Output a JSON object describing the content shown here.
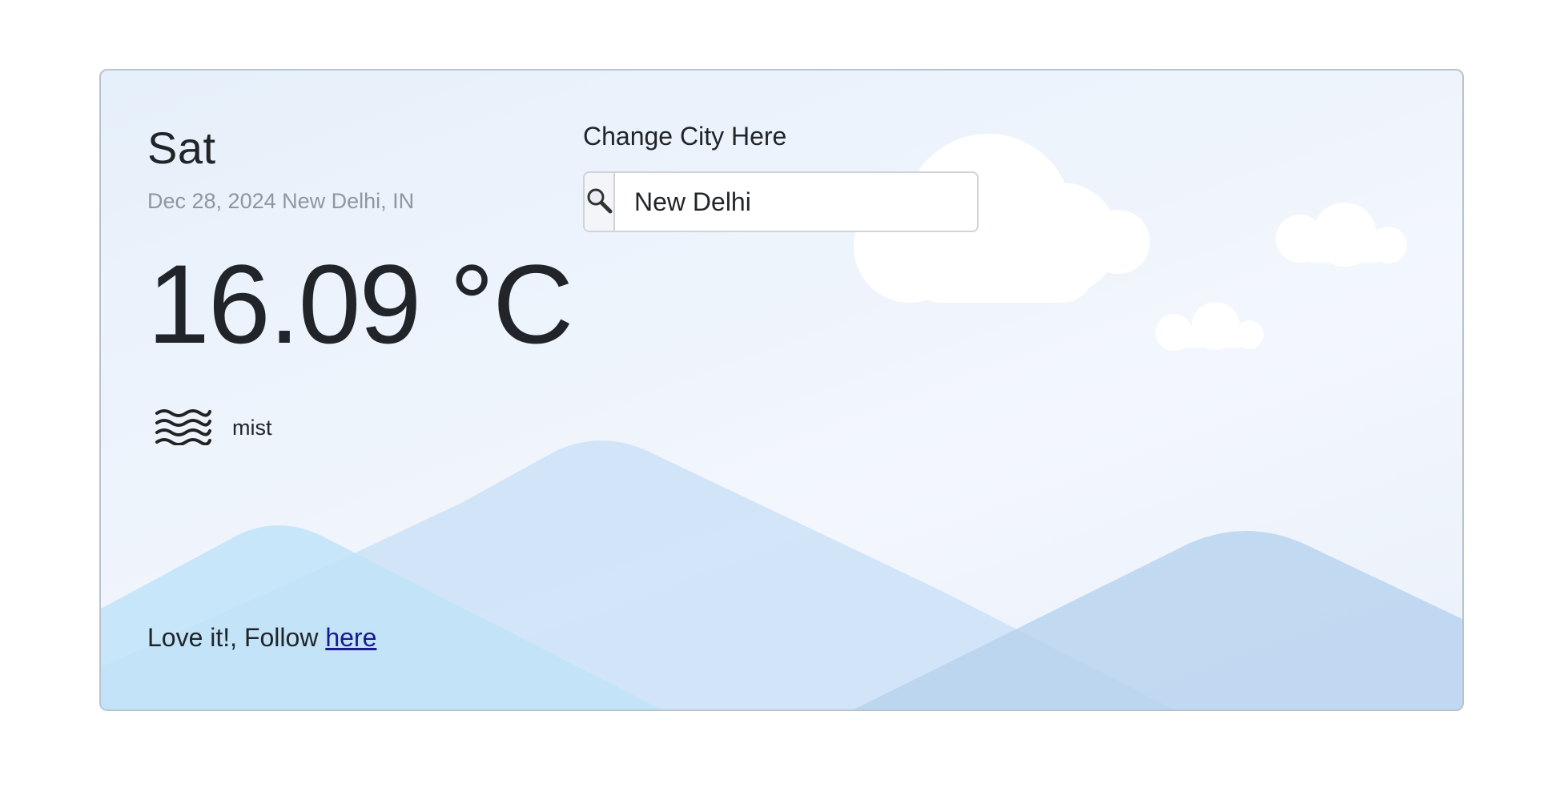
{
  "weather": {
    "day": "Sat",
    "date_location": "Dec 28, 2024 New Delhi, IN",
    "temperature": "16.09 °C",
    "condition": "mist",
    "condition_icon": "mist-icon"
  },
  "search": {
    "label": "Change City Here",
    "value": "New Delhi",
    "icon": "search-icon"
  },
  "footer": {
    "text": "Love it!, Follow ",
    "link_text": "here"
  }
}
